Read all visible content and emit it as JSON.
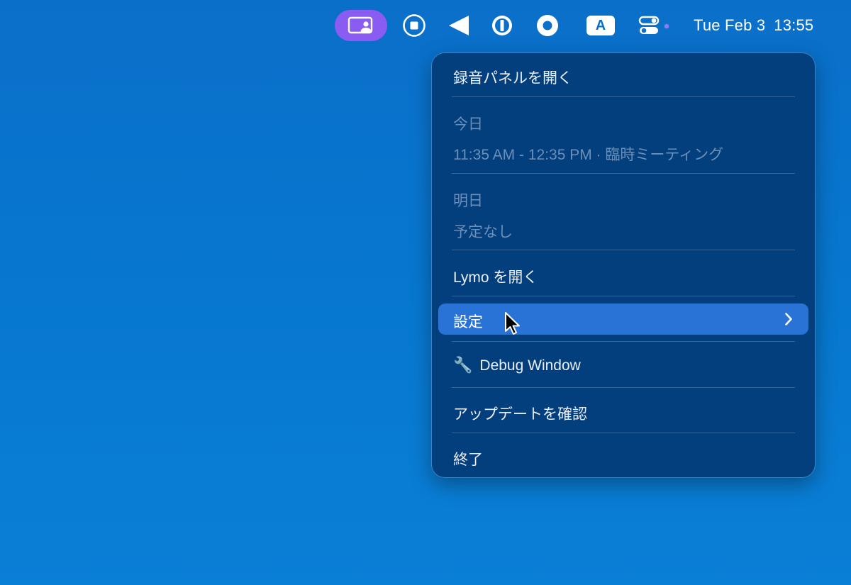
{
  "menubar": {
    "icons": [
      {
        "name": "screen-share-person-icon"
      },
      {
        "name": "stop-record-icon"
      },
      {
        "name": "back-arrow-icon"
      },
      {
        "name": "password-manager-icon"
      },
      {
        "name": "circle-app-icon"
      },
      {
        "name": "input-source-icon",
        "label": "A"
      },
      {
        "name": "control-center-icon"
      }
    ],
    "clock": {
      "date": "Tue Feb 3",
      "time": "13:55"
    },
    "app_accent": "#8a5cf2"
  },
  "menu": {
    "open_recording_panel": "録音パネルを開く",
    "today_header": "今日",
    "today_event": "11:35 AM - 12:35 PM · 臨時ミーティング",
    "tomorrow_header": "明日",
    "tomorrow_event": "予定なし",
    "open_app": "Lymo を開く",
    "settings": "設定",
    "debug_window": "Debug Window",
    "debug_icon": "🔧",
    "check_updates": "アップデートを確認",
    "quit": "終了",
    "highlight_color": "#2a73d6",
    "background_color": "#033f7c"
  }
}
